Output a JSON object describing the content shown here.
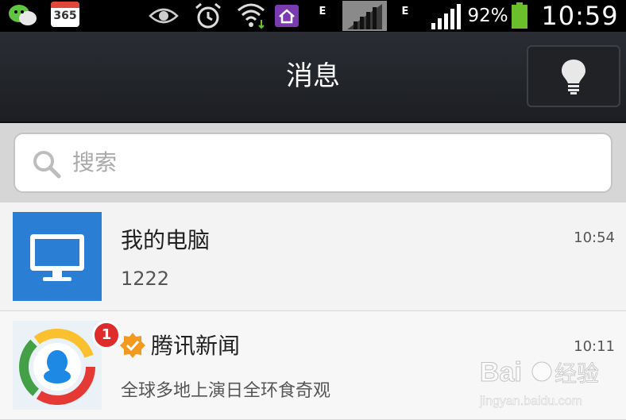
{
  "status_bar": {
    "calendar_number": "365",
    "network_mark_1": "E",
    "network_mark_2": "E",
    "battery_percent": "92%",
    "time": "10:59",
    "icons": [
      "wechat-icon",
      "calendar-icon",
      "eye-icon",
      "alarm-icon",
      "wifi-icon",
      "home-icon",
      "signal-icon",
      "battery-icon"
    ]
  },
  "header": {
    "title": "消息"
  },
  "search": {
    "placeholder": "搜索"
  },
  "chats": [
    {
      "name": "我的电脑",
      "preview": "1222",
      "time": "10:54",
      "avatar": "computer-icon"
    },
    {
      "name": "腾讯新闻",
      "preview": "全球多地上演日全环食奇观",
      "time": "10:11",
      "avatar": "tencent-news-logo",
      "unread": "1",
      "verified": true
    }
  ],
  "watermark": {
    "brand": "Baidu经验",
    "url": "jingyan.baidu.com"
  },
  "colors": {
    "titlebar": "#1c1e22",
    "accent_blue": "#2a7fd4",
    "battery_green": "#6bbf2a",
    "badge_red": "#e02b2b",
    "verified_orange": "#f39a1e"
  }
}
